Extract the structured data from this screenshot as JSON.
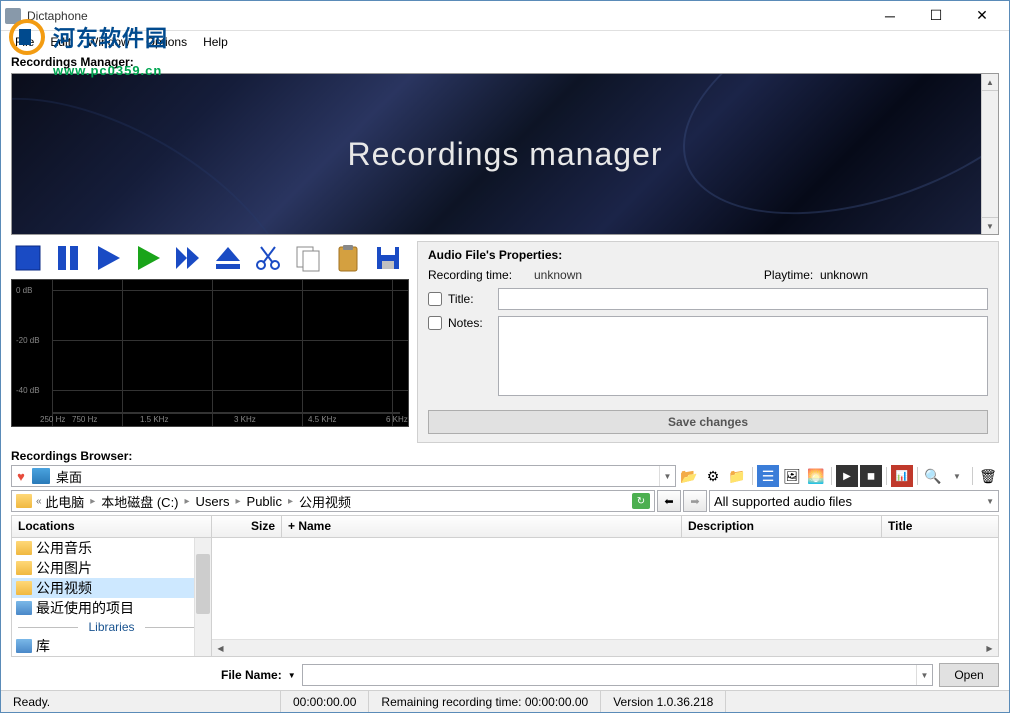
{
  "window": {
    "title": "Dictaphone"
  },
  "watermark": {
    "text": "河东软件园",
    "sub": "www.pc0359.cn"
  },
  "menu": {
    "file": "File",
    "edit": "Edit",
    "window": "Window",
    "options": "Options",
    "help": "Help"
  },
  "sections": {
    "recordings_manager": "Recordings Manager:",
    "recordings_browser": "Recordings Browser:"
  },
  "banner": {
    "title": "Recordings manager"
  },
  "props": {
    "title": "Audio File's Properties:",
    "rec_label": "Recording time:",
    "rec_val": "unknown",
    "play_label": "Playtime:",
    "play_val": "unknown",
    "title_label": "Title:",
    "title_value": "",
    "notes_label": "Notes:",
    "notes_value": "",
    "save_btn": "Save changes"
  },
  "spectrum": {
    "y_labels": [
      "0 dB",
      "-20 dB",
      "-40 dB"
    ],
    "x_labels": [
      "250 Hz",
      "750 Hz",
      "1.5 KHz",
      "3 KHz",
      "4.5 KHz",
      "6 KHz"
    ]
  },
  "browser": {
    "address": "桌面",
    "breadcrumb": [
      "此电脑",
      "本地磁盘 (C:)",
      "Users",
      "Public",
      "公用视频"
    ],
    "filter": "All supported audio files",
    "columns": {
      "locations": "Locations",
      "size": "Size",
      "name": "+ Name",
      "description": "Description",
      "title": "Title"
    },
    "locations": [
      "公用音乐",
      "公用图片",
      "公用视频",
      "最近使用的项目"
    ],
    "loc_divider": "Libraries",
    "loc_extra": "库",
    "filename_label": "File Name:",
    "filename_value": "",
    "open_btn": "Open"
  },
  "status": {
    "ready": "Ready.",
    "time": "00:00:00.00",
    "remaining_label": "Remaining recording time:",
    "remaining_val": "00:00:00.00",
    "version": "Version 1.0.36.218"
  }
}
